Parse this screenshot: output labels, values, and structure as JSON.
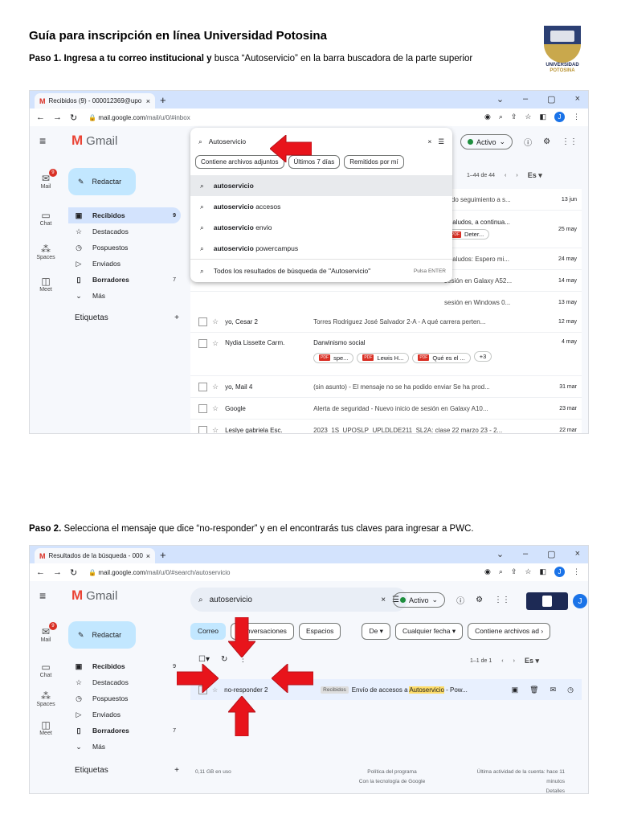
{
  "doc": {
    "title": "Guía para inscripción en línea Universidad Potosina",
    "step1_bold": "Paso 1. Ingresa a tu correo institucional y",
    "step1_rest": " busca “Autoservicio” en la barra buscadora de la parte superior",
    "step2_bold": "Paso 2.",
    "step2_rest": " Selecciona el mensaje que dice “no-responder” y en el encontrarás tus claves para ingresar a PWC.",
    "logo_line1": "UNIVERSIDAD",
    "logo_line2": "POTOSINA"
  },
  "colors": {
    "arrow": "#e8141b",
    "compose": "#c2e7ff",
    "active_nav": "#d3e3fd"
  },
  "shot1": {
    "tab_title": "Recibidos (9) - 000012369@upo",
    "url_domain": "mail.google.com",
    "url_path": "/mail/u/0/#inbox",
    "gmail_label": "Gmail",
    "compose": "Redactar",
    "rail": [
      "Mail",
      "Chat",
      "Spaces",
      "Meet"
    ],
    "mail_badge": "9",
    "nav": [
      {
        "label": "Recibidos",
        "count": "9"
      },
      {
        "label": "Destacados",
        "count": ""
      },
      {
        "label": "Pospuestos",
        "count": ""
      },
      {
        "label": "Enviados",
        "count": ""
      },
      {
        "label": "Borradores",
        "count": "7"
      },
      {
        "label": "Más",
        "count": ""
      }
    ],
    "labels_heading": "Etiquetas",
    "labels_add": "+",
    "search_query": "Autoservicio",
    "filters": [
      "Contiene archivos adjuntos",
      "Últimos 7 días",
      "Remitidos por mí"
    ],
    "suggestions": [
      {
        "bold": "autoservicio",
        "rest": ""
      },
      {
        "bold": "autoservicio",
        "rest": " accesos"
      },
      {
        "bold": "autoservicio",
        "rest": " envio"
      },
      {
        "bold": "autoservicio",
        "rest": " powercampus"
      }
    ],
    "all_results": "Todos los resultados de búsqueda de \"Autoservicio\"",
    "press_enter": "Pulsa ENTER",
    "status": "Activo",
    "pager": "1–44 de 44",
    "lang": "Es",
    "bg_rows": [
      {
        "subj": "ando seguimiento a s...",
        "date": "13 jun"
      },
      {
        "subj": "- Saludos, a continua...",
        "date": "25 may"
      },
      {
        "subj": "- Saludos: Espero mi...",
        "date": "24 may"
      },
      {
        "subj": "sesión en Galaxy A52...",
        "date": "14 may"
      },
      {
        "subj": "sesión en Windows 0...",
        "date": "13 may"
      }
    ],
    "bg_chip": "Deter...",
    "rows": [
      {
        "from": "yo, Cesar 2",
        "subj": "Torres Rodriguez José Salvador 2-A - A qué carrera perten...",
        "date": "12 may"
      },
      {
        "from": "Nydia Lissette Carm.",
        "subj": "Darwinismo social",
        "date": "4 may"
      },
      {
        "from": "yo, Mail 4",
        "subj": "(sin asunto) - El mensaje no se ha podido enviar Se ha prod...",
        "date": "31 mar"
      },
      {
        "from": "Google",
        "subj": "Alerta de seguridad - Nuevo inicio de sesión en Galaxy A10...",
        "date": "23 mar"
      },
      {
        "from": "Leslye gabriela Esc.",
        "subj": "2023_1S_UPOSLP_UPLDLDE211_SL2A: clase 22 marzo 23 - 2...",
        "date": "22 mar"
      }
    ],
    "chips": [
      "spe...",
      "Lewis H...",
      "Qué es el ...",
      "+3"
    ]
  },
  "shot2": {
    "tab_title": "Resultados de la búsqueda - 000",
    "url_domain": "mail.google.com",
    "url_path": "/mail/u/0/#search/autoservicio",
    "search_query": "autoservicio",
    "status": "Activo",
    "tabs": [
      "Correo",
      "Conversaciones",
      "Espacios"
    ],
    "filters": [
      "De",
      "Cualquier fecha",
      "Contiene archivos ad"
    ],
    "pager": "1–1 de 1",
    "lang": "Es",
    "result_from": "no-responder 2",
    "result_tag": "Recibidos",
    "result_subj_pre": "Envío de accesos a ",
    "result_subj_hl": "Autoservicio",
    "result_subj_post": " - Pow...",
    "footer_storage": "0,11 GB en uso",
    "footer_policy1": "Política del programa",
    "footer_policy2": "Con la tecnología de Google",
    "footer_activity1": "Última actividad de la cuenta: hace 11",
    "footer_activity2": "minutos",
    "footer_activity3": "Detalles"
  }
}
